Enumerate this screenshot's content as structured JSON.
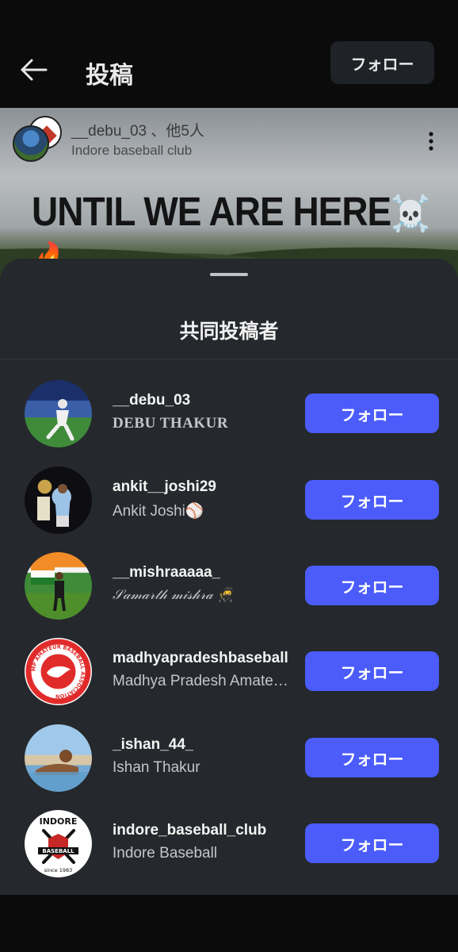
{
  "topbar": {
    "title": "投稿",
    "follow_label": "フォロー"
  },
  "post": {
    "user_line": "__debu_03 、他5人",
    "sub_line": "Indore baseball club",
    "headline": "UNTIL WE ARE HERE",
    "headline_emoji": "☠️🔥"
  },
  "sheet": {
    "title": "共同投稿者",
    "follow_label": "フォロー",
    "collaborators": [
      {
        "username": "__debu_03",
        "name": "DEBU THAKUR"
      },
      {
        "username": "ankit__joshi29",
        "name": "Ankit Joshi⚾"
      },
      {
        "username": "__mishraaaaa_",
        "name": "𝒮𝒶𝓂𝒶𝓇𝓉𝒽 𝓂𝒾𝓈𝒽𝓇𝒶 🥷"
      },
      {
        "username": "madhyapradeshbaseball",
        "name": "Madhya Pradesh Amateur Baseball Association"
      },
      {
        "username": "_ishan_44_",
        "name": "Ishan Thakur"
      },
      {
        "username": "indore_baseball_club",
        "name": "Indore Baseball"
      }
    ]
  },
  "logos": {
    "mp_ring_text": "MP AMATEUR BASEBALL ASSOCIATION",
    "indore_top": "INDORE",
    "indore_band": "BASEBALL",
    "indore_since": "since 1983"
  },
  "colors": {
    "accent": "#4b5cfa",
    "sheet_bg": "#25282c",
    "app_bg": "#0b0b0c"
  }
}
